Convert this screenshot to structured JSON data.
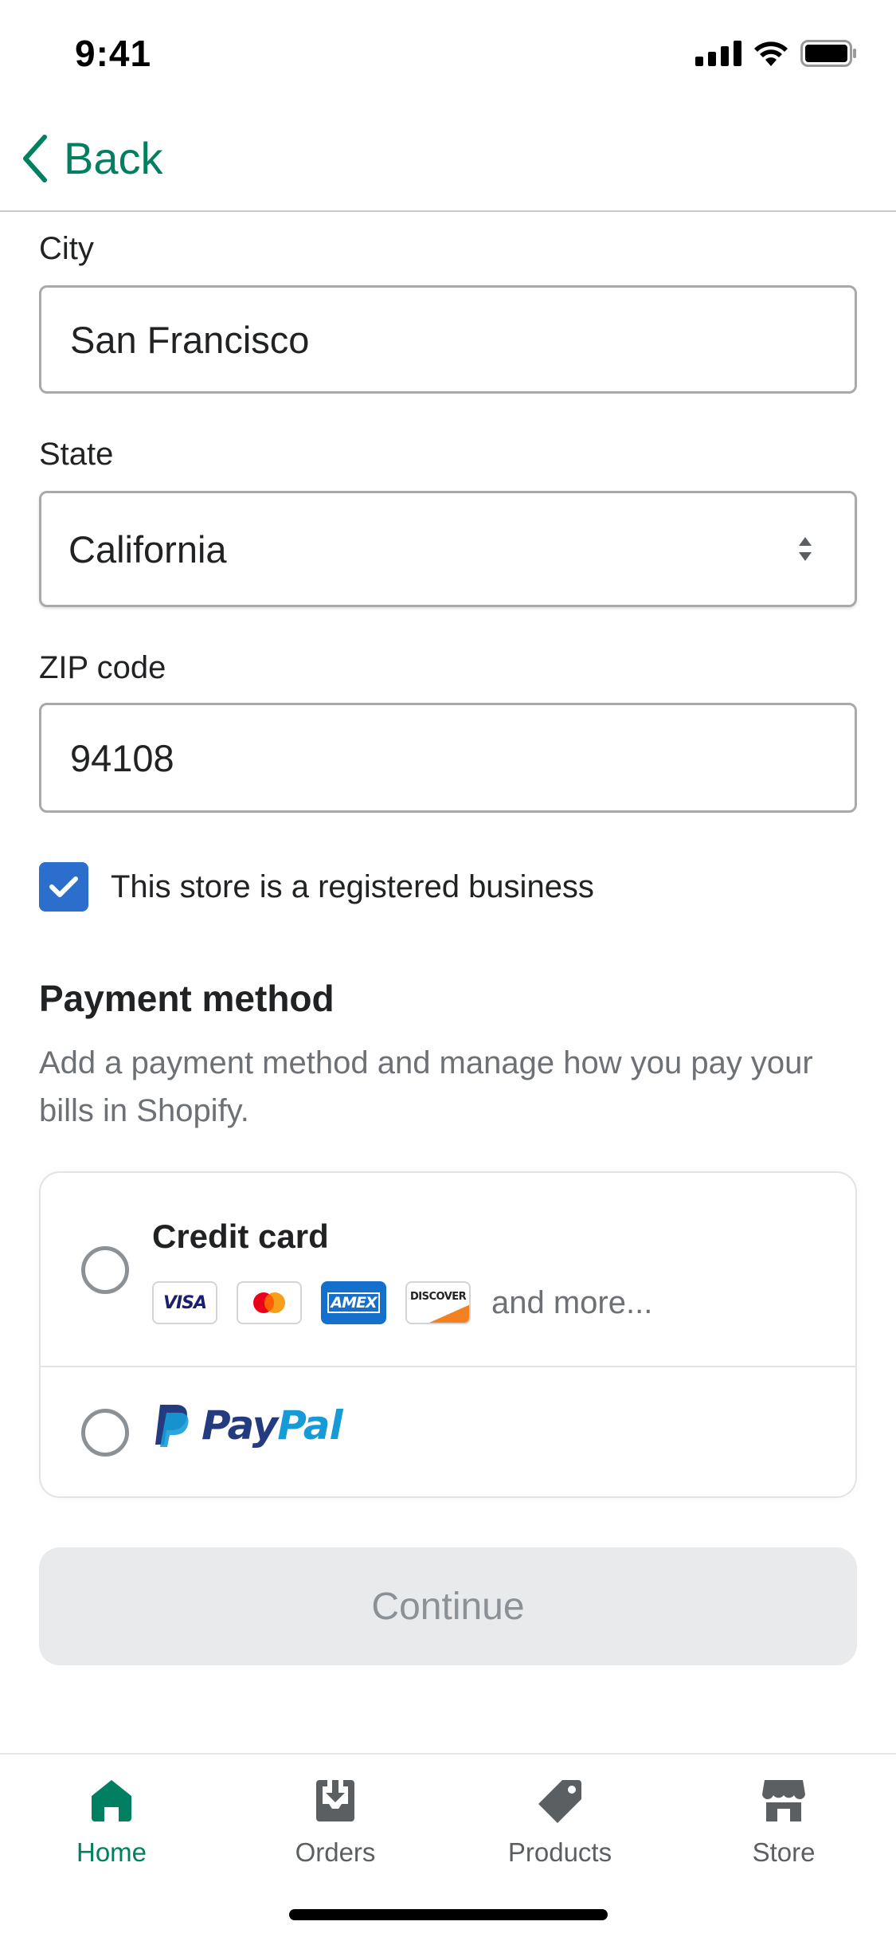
{
  "status_bar": {
    "time": "9:41"
  },
  "nav": {
    "back_label": "Back"
  },
  "form": {
    "city_label": "City",
    "city_value": "San Francisco",
    "state_label": "State",
    "state_value": "California",
    "zip_label": "ZIP code",
    "zip_value": "94108",
    "registered_business_label": "This store is a registered business",
    "registered_business_checked": true
  },
  "payment": {
    "title": "Payment method",
    "description": "Add a payment method and manage how you pay your bills in Shopify.",
    "credit_card_label": "Credit card",
    "card_brands": [
      "VISA",
      "Mastercard",
      "AMEX",
      "DISCOVER"
    ],
    "and_more": "and more...",
    "paypal_part1": "Pay",
    "paypal_part2": "Pal"
  },
  "continue_label": "Continue",
  "tabs": [
    {
      "label": "Home",
      "icon": "home-icon",
      "active": true
    },
    {
      "label": "Orders",
      "icon": "orders-icon",
      "active": false
    },
    {
      "label": "Products",
      "icon": "tag-icon",
      "active": false
    },
    {
      "label": "Store",
      "icon": "store-icon",
      "active": false
    }
  ],
  "colors": {
    "accent": "#008060",
    "checkbox": "#2c6ecb",
    "text": "#202223",
    "subdued": "#6d7175",
    "disabled_button": "#e9eaec"
  }
}
